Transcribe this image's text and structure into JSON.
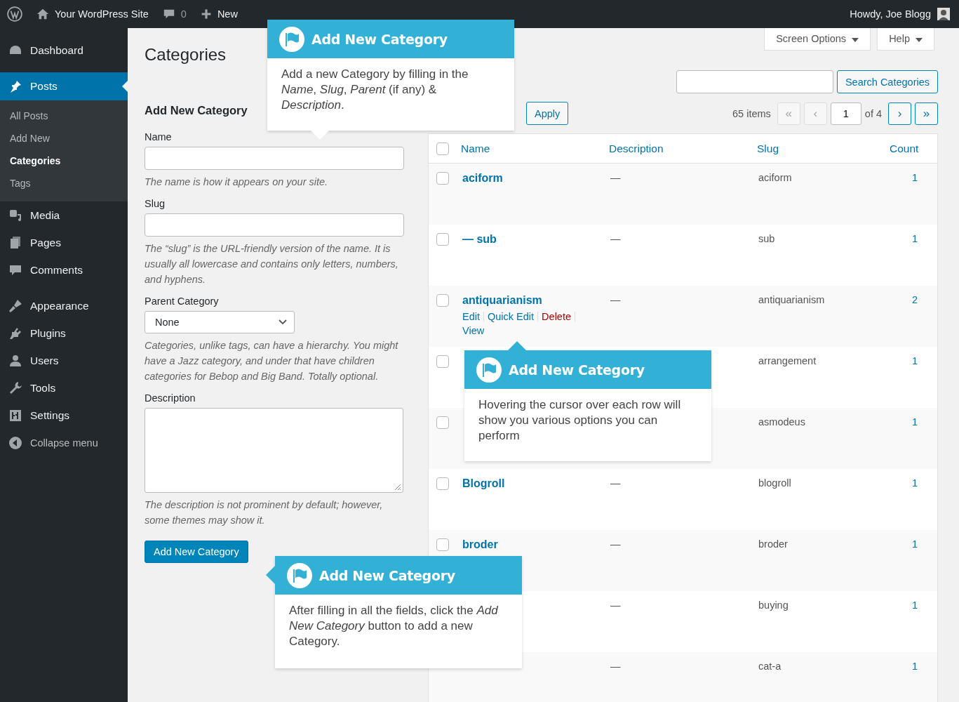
{
  "admin_bar": {
    "site_name": "Your WordPress Site",
    "comments_count": "0",
    "new_label": "New",
    "greeting": "Howdy, Joe Blogg"
  },
  "sidebar": {
    "items": [
      {
        "label": "Dashboard",
        "selected": false
      },
      {
        "label": "Posts",
        "selected": true,
        "children": [
          {
            "label": "All Posts",
            "selected": false
          },
          {
            "label": "Add New",
            "selected": false
          },
          {
            "label": "Categories",
            "selected": true
          },
          {
            "label": "Tags",
            "selected": false
          }
        ]
      },
      {
        "label": "Media",
        "selected": false
      },
      {
        "label": "Pages",
        "selected": false
      },
      {
        "label": "Comments",
        "selected": false
      },
      {
        "label": "Appearance",
        "selected": false
      },
      {
        "label": "Plugins",
        "selected": false
      },
      {
        "label": "Users",
        "selected": false
      },
      {
        "label": "Tools",
        "selected": false
      },
      {
        "label": "Settings",
        "selected": false
      },
      {
        "label": "Collapse menu",
        "selected": false
      }
    ]
  },
  "page_title": "Categories",
  "screen_buttons": [
    "Screen Options",
    "Help"
  ],
  "form": {
    "heading": "Add New Category",
    "fields": [
      {
        "kind": "text",
        "label": "Name",
        "hint": "The name is how it appears on your site."
      },
      {
        "kind": "text",
        "label": "Slug",
        "hint": "The “slug” is the URL-friendly version of the name. It is usually all lowercase and contains only letters, numbers, and hyphens."
      },
      {
        "kind": "select",
        "label": "Parent Category",
        "value": "None",
        "hint": "Categories, unlike tags, can have a hierarchy. You might have a Jazz category, and under that have children categories for Bebop and Big Band. Totally optional."
      },
      {
        "kind": "textarea",
        "label": "Description",
        "hint": "The description is not prominent by default; however, some themes may show it."
      }
    ],
    "submit": "Add New Category"
  },
  "search_button": "Search Categories",
  "apply_button": "Apply",
  "items_count": "65 items",
  "pager": {
    "buttons": [
      {
        "label": "«",
        "disabled": true
      },
      {
        "label": "‹",
        "disabled": true
      }
    ],
    "page": "1",
    "of": "of 4",
    "next_buttons": [
      {
        "label": "›",
        "disabled": false
      },
      {
        "label": "»",
        "disabled": false
      }
    ]
  },
  "table": {
    "header_checked": false,
    "columns": [
      "Name",
      "Description",
      "Slug",
      "Count"
    ],
    "rows": [
      {
        "name": "aciform",
        "description": "—",
        "slug": "aciform",
        "count": "1",
        "checked": false
      },
      {
        "name": "— sub",
        "description": "—",
        "slug": "sub",
        "count": "1",
        "checked": false
      },
      {
        "name": "antiquarianism",
        "description": "—",
        "slug": "antiquarianism",
        "count": "2",
        "checked": false,
        "actions": [
          {
            "label": "Edit",
            "kind": "link"
          },
          {
            "label": "Quick Edit",
            "kind": "link"
          },
          {
            "label": "Delete",
            "kind": "delete"
          },
          {
            "label": "View",
            "kind": "link"
          }
        ]
      },
      {
        "slug": "arrangement",
        "count": "1",
        "checked": false
      },
      {
        "slug": "asmodeus",
        "count": "1",
        "checked": false
      },
      {
        "name": "Blogroll",
        "description": "—",
        "slug": "blogroll",
        "count": "1",
        "checked": false
      },
      {
        "name": "broder",
        "description": "—",
        "slug": "broder",
        "count": "1",
        "checked": false
      },
      {
        "description": "—",
        "slug": "buying",
        "count": "1"
      },
      {
        "description": "—",
        "slug": "cat-a",
        "count": "1"
      }
    ]
  },
  "pointers": [
    {
      "title": "Add New Category",
      "body": "Add a new Category by filling in the *Name*, *Slug*, *Parent* (if any) & *Description*."
    },
    {
      "title": "Add New Category",
      "body": "Hovering the cursor over each row will show you various options you can perform"
    },
    {
      "title": "Add New Category",
      "body": "After filling in all the fields, click the *Add New Category* button to add a new Category."
    }
  ]
}
